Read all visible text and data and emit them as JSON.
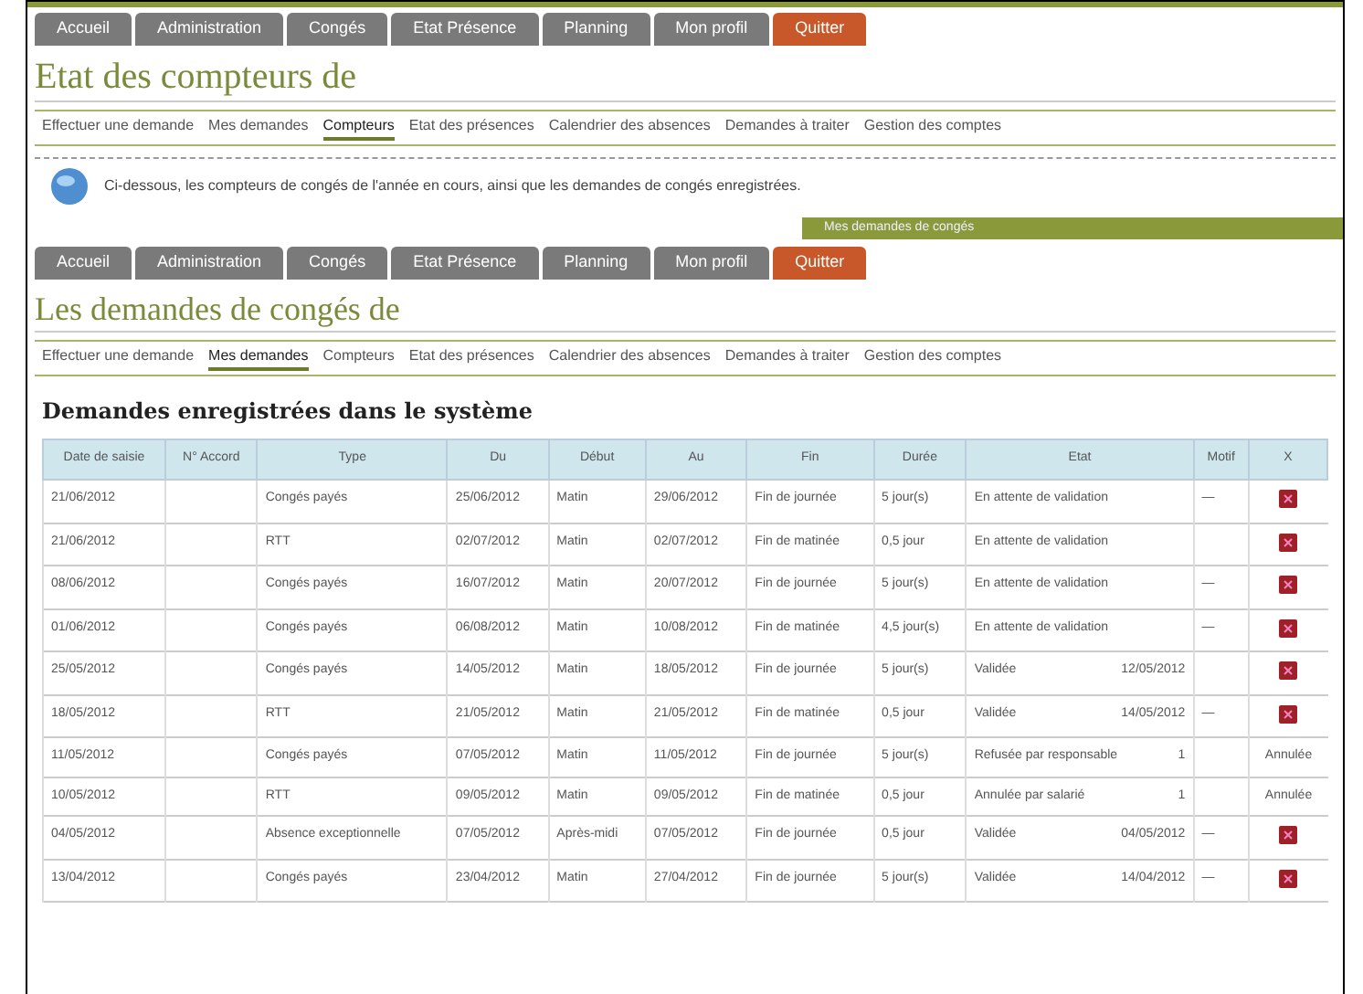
{
  "top_nav": {
    "items": [
      {
        "label": "Accueil",
        "selected": false
      },
      {
        "label": "Administration",
        "selected": false
      },
      {
        "label": "Congés",
        "selected": false
      },
      {
        "label": "Etat Présence",
        "selected": false
      },
      {
        "label": "Planning",
        "selected": false
      },
      {
        "label": "Mon profil",
        "selected": false
      },
      {
        "label": "Quitter",
        "selected": true
      }
    ]
  },
  "counters_section": {
    "title": "Etat des compteurs de",
    "sub_nav": [
      {
        "label": "Effectuer une demande",
        "selected": false
      },
      {
        "label": "Mes demandes",
        "selected": false
      },
      {
        "label": "Compteurs",
        "selected": true
      },
      {
        "label": "Etat des présences",
        "selected": false
      },
      {
        "label": "Calendrier des absences",
        "selected": false
      },
      {
        "label": "Demandes à traiter",
        "selected": false
      },
      {
        "label": "Gestion des comptes",
        "selected": false
      }
    ],
    "info": "Ci-dessous, les compteurs de congés de l'année en cours, ainsi que les demandes de congés enregistrées.",
    "side_bar": "Mes demandes de congés"
  },
  "second_nav": {
    "items": [
      {
        "label": "Accueil",
        "selected": false
      },
      {
        "label": "Administration",
        "selected": false
      },
      {
        "label": "Congés",
        "selected": false
      },
      {
        "label": "Etat Présence",
        "selected": false
      },
      {
        "label": "Planning",
        "selected": false
      },
      {
        "label": "Mon profil",
        "selected": false
      },
      {
        "label": "Quitter",
        "selected": true
      }
    ]
  },
  "requests_section": {
    "title": "Les demandes de congés de",
    "sub_nav": [
      {
        "label": "Effectuer une demande",
        "selected": false
      },
      {
        "label": "Mes demandes",
        "selected": true
      },
      {
        "label": "Compteurs",
        "selected": false
      },
      {
        "label": "Etat des présences",
        "selected": false
      },
      {
        "label": "Calendrier des absences",
        "selected": false
      },
      {
        "label": "Demandes à traiter",
        "selected": false
      },
      {
        "label": "Gestion des comptes",
        "selected": false
      }
    ],
    "heading": "Demandes enregistrées dans le système",
    "table": {
      "columns": [
        "Date de saisie",
        "N° Accord",
        "Type",
        "Du",
        "Début",
        "Au",
        "Fin",
        "Durée",
        "Etat",
        "Motif",
        "X"
      ],
      "rows": [
        {
          "cells": [
            "21/06/2012",
            "",
            "Congés payés",
            "25/06/2012",
            "Matin",
            "29/06/2012",
            "Fin de journée",
            "5 jour(s)",
            "En attente de validation",
            "—"
          ],
          "kind": "delete"
        },
        {
          "cells": [
            "21/06/2012",
            "",
            "RTT",
            "02/07/2012",
            "Matin",
            "02/07/2012",
            "Fin de matinée",
            "0,5 jour",
            "En attente de validation",
            ""
          ],
          "kind": "delete"
        },
        {
          "cells": [
            "08/06/2012",
            "",
            "Congés payés",
            "16/07/2012",
            "Matin",
            "20/07/2012",
            "Fin de journée",
            "5 jour(s)",
            "En attente de validation",
            "—"
          ],
          "kind": "delete"
        },
        {
          "cells": [
            "01/06/2012",
            "",
            "Congés payés",
            "06/08/2012",
            "Matin",
            "10/08/2012",
            "Fin de matinée",
            "4,5 jour(s)",
            "En attente de validation",
            "—"
          ],
          "kind": "delete"
        },
        {
          "cells": [
            "25/05/2012",
            "",
            "Congés payés",
            "14/05/2012",
            "Matin",
            "18/05/2012",
            "Fin de journée",
            "5 jour(s)",
            "Validée",
            ""
          ],
          "note": "12/05/2012",
          "kind": "delete"
        },
        {
          "cells": [
            "18/05/2012",
            "",
            "RTT",
            "21/05/2012",
            "Matin",
            "21/05/2012",
            "Fin de matinée",
            "0,5 jour",
            "Validée",
            "—"
          ],
          "note": "14/05/2012",
          "kind": "delete"
        },
        {
          "cells": [
            "11/05/2012",
            "",
            "Congés payés",
            "07/05/2012",
            "Matin",
            "11/05/2012",
            "Fin de journée",
            "5 jour(s)",
            "Refusée par responsable",
            ""
          ],
          "note": "1",
          "kind": "text",
          "status": "Annulée"
        },
        {
          "cells": [
            "10/05/2012",
            "",
            "RTT",
            "09/05/2012",
            "Matin",
            "09/05/2012",
            "Fin de matinée",
            "0,5 jour",
            "Annulée par salarié",
            ""
          ],
          "note": "1",
          "kind": "text",
          "status": "Annulée"
        },
        {
          "cells": [
            "04/05/2012",
            "",
            "Absence exceptionnelle",
            "07/05/2012",
            "Après-midi",
            "07/05/2012",
            "Fin de journée",
            "0,5 jour",
            "Validée",
            "—"
          ],
          "note": "04/05/2012",
          "kind": "delete"
        },
        {
          "cells": [
            "13/04/2012",
            "",
            "Congés payés",
            "23/04/2012",
            "Matin",
            "27/04/2012",
            "Fin de journée",
            "5 jour(s)",
            "Validée",
            "—"
          ],
          "note": "14/04/2012",
          "kind": "delete"
        }
      ]
    }
  }
}
